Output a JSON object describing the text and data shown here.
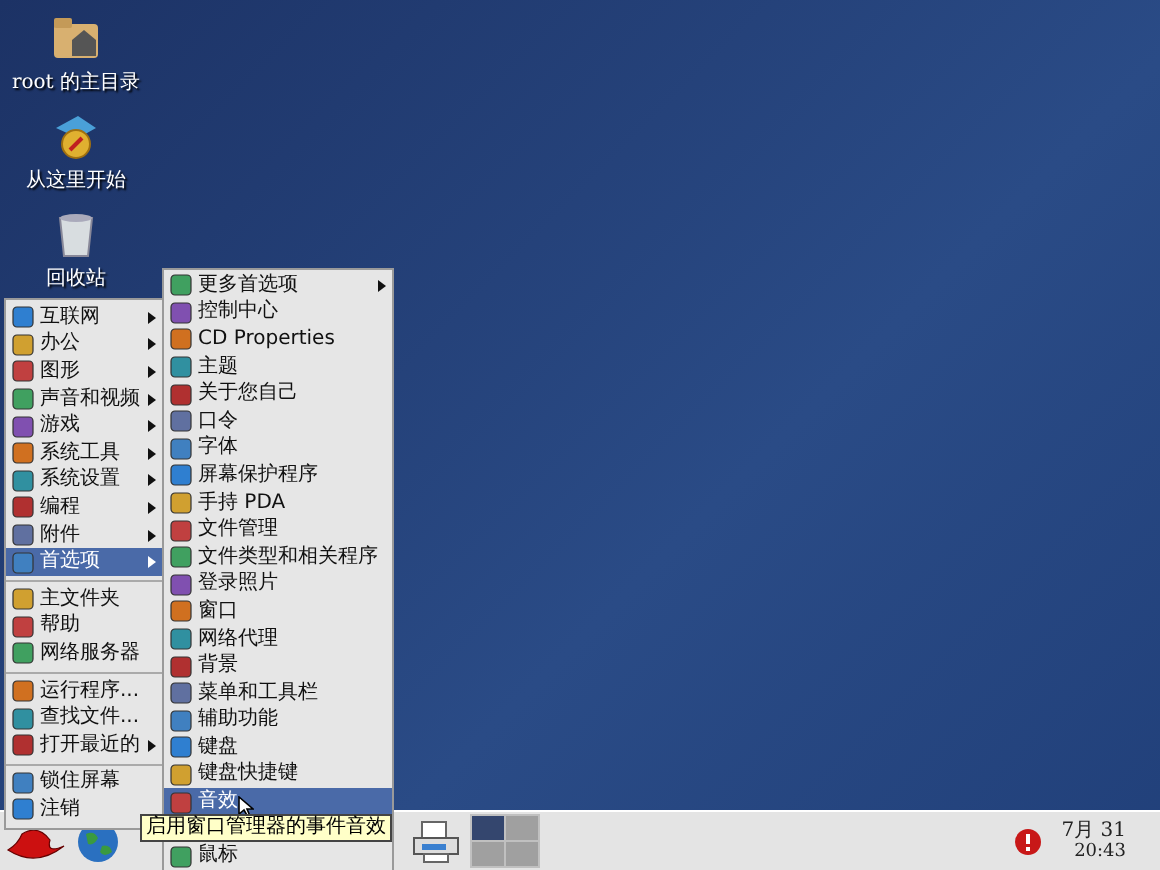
{
  "desktop_icons": [
    {
      "label": "root 的主目录"
    },
    {
      "label": "从这里开始"
    },
    {
      "label": "回收站"
    }
  ],
  "main_menu": {
    "items": [
      {
        "kind": "item",
        "label": "互联网",
        "submenu": true,
        "selected": false
      },
      {
        "kind": "item",
        "label": "办公",
        "submenu": true,
        "selected": false
      },
      {
        "kind": "item",
        "label": "图形",
        "submenu": true,
        "selected": false
      },
      {
        "kind": "item",
        "label": "声音和视频",
        "submenu": true,
        "selected": false
      },
      {
        "kind": "item",
        "label": "游戏",
        "submenu": true,
        "selected": false
      },
      {
        "kind": "item",
        "label": "系统工具",
        "submenu": true,
        "selected": false
      },
      {
        "kind": "item",
        "label": "系统设置",
        "submenu": true,
        "selected": false
      },
      {
        "kind": "item",
        "label": "编程",
        "submenu": true,
        "selected": false
      },
      {
        "kind": "item",
        "label": "附件",
        "submenu": true,
        "selected": false
      },
      {
        "kind": "item",
        "label": "首选项",
        "submenu": true,
        "selected": true
      },
      {
        "kind": "separator"
      },
      {
        "kind": "item",
        "label": "主文件夹",
        "submenu": false,
        "selected": false
      },
      {
        "kind": "item",
        "label": "帮助",
        "submenu": false,
        "selected": false
      },
      {
        "kind": "item",
        "label": "网络服务器",
        "submenu": false,
        "selected": false
      },
      {
        "kind": "separator"
      },
      {
        "kind": "item",
        "label": "运行程序...",
        "submenu": false,
        "selected": false
      },
      {
        "kind": "item",
        "label": "查找文件...",
        "submenu": false,
        "selected": false
      },
      {
        "kind": "item",
        "label": "打开最近的",
        "submenu": true,
        "selected": false
      },
      {
        "kind": "separator"
      },
      {
        "kind": "item",
        "label": "锁住屏幕",
        "submenu": false,
        "selected": false
      },
      {
        "kind": "item",
        "label": "注销",
        "submenu": false,
        "selected": false
      }
    ]
  },
  "sub_menu": {
    "items": [
      {
        "label": "更多首选项",
        "submenu": true,
        "selected": false
      },
      {
        "label": "控制中心",
        "submenu": false,
        "selected": false
      },
      {
        "label": "CD  Properties",
        "submenu": false,
        "selected": false
      },
      {
        "label": "主题",
        "submenu": false,
        "selected": false
      },
      {
        "label": "关于您自己",
        "submenu": false,
        "selected": false
      },
      {
        "label": "口令",
        "submenu": false,
        "selected": false
      },
      {
        "label": "字体",
        "submenu": false,
        "selected": false
      },
      {
        "label": "屏幕保护程序",
        "submenu": false,
        "selected": false
      },
      {
        "label": "手持  PDA",
        "submenu": false,
        "selected": false
      },
      {
        "label": "文件管理",
        "submenu": false,
        "selected": false
      },
      {
        "label": "文件类型和相关程序",
        "submenu": false,
        "selected": false
      },
      {
        "label": "登录照片",
        "submenu": false,
        "selected": false
      },
      {
        "label": "窗口",
        "submenu": false,
        "selected": false
      },
      {
        "label": "网络代理",
        "submenu": false,
        "selected": false
      },
      {
        "label": "背景",
        "submenu": false,
        "selected": false
      },
      {
        "label": "菜单和工具栏",
        "submenu": false,
        "selected": false
      },
      {
        "label": "辅助功能",
        "submenu": false,
        "selected": false
      },
      {
        "label": "键盘",
        "submenu": false,
        "selected": false
      },
      {
        "label": "键盘快捷键",
        "submenu": false,
        "selected": false
      },
      {
        "label": "音效",
        "submenu": false,
        "selected": true
      },
      {
        "label": "鼠标",
        "submenu": false,
        "selected": false,
        "covered_above": true
      }
    ]
  },
  "tooltip": "启用窗口管理器的事件音效",
  "taskbar": {
    "workspaces": [
      {
        "selected": true
      },
      {
        "selected": false
      },
      {
        "selected": false
      },
      {
        "selected": false
      }
    ],
    "clock_date": "7月 31",
    "clock_time": "20:43"
  }
}
